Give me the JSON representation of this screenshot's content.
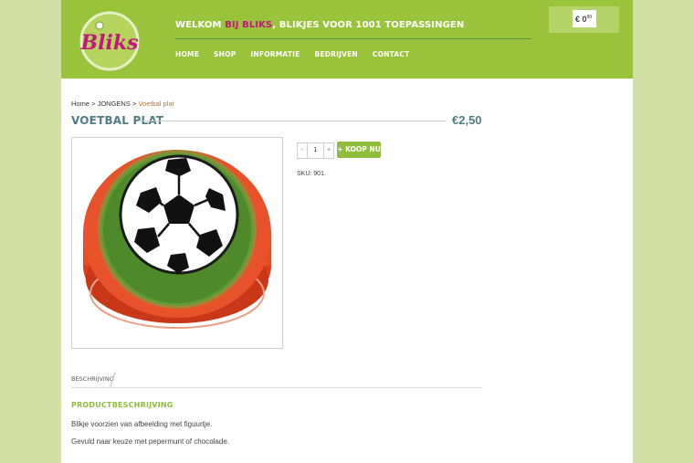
{
  "header": {
    "welcome_prefix": "WELKOM",
    "welcome_highlight": "BIJ BLIKS",
    "welcome_suffix": ", BLIKJES VOOR 1001 TOEPASSINGEN",
    "logo_text": "Bliks"
  },
  "nav": [
    {
      "label": "HOME"
    },
    {
      "label": "SHOP"
    },
    {
      "label": "INFORMATIE"
    },
    {
      "label": "BEDRIJVEN"
    },
    {
      "label": "CONTACT"
    }
  ],
  "cart": {
    "amount": "€ 0",
    "cents": "00"
  },
  "breadcrumb": {
    "home": "Home",
    "sep1": ">",
    "category": "JONGENS",
    "sep2": ">",
    "current": "Voetbal plat"
  },
  "product": {
    "title": "VOETBAL PLAT",
    "price": "€2,50",
    "quantity": "1",
    "minus": "-",
    "plus": "+",
    "buy_label": "+ KOOP NU",
    "sku": "SKU: 901."
  },
  "tabs": [
    {
      "label": "BESCHRIJVING"
    }
  ],
  "description": {
    "title": "PRODUCTBESCHRIJVING",
    "paragraphs": [
      "Blikje voorzien van afbeelding met figuurtje.",
      "Gevuld naar keuze met pepermunt of chocolade."
    ]
  },
  "colors": {
    "header": "#9ac33c",
    "accent_green": "#8fbf3a",
    "accent_pink": "#c2177d",
    "title_teal": "#4f7b84",
    "breadcrumb_current": "#d0731e"
  }
}
